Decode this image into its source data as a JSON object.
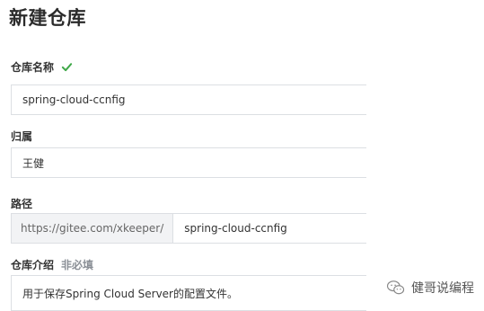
{
  "page": {
    "title": "新建仓库"
  },
  "form": {
    "repo_name": {
      "label": "仓库名称",
      "value": "spring-cloud-ccnfig",
      "valid_icon": "check-icon",
      "valid_color": "#3fa848"
    },
    "owner": {
      "label": "归属",
      "value": "王健"
    },
    "path": {
      "label": "路径",
      "prefix": "https://gitee.com/xkeeper/",
      "value": "spring-cloud-ccnfig"
    },
    "description": {
      "label": "仓库介绍",
      "optional_label": "非必填",
      "value": "用于保存Spring Cloud Server的配置文件。"
    }
  },
  "watermark": {
    "icon": "wechat-icon",
    "text": "健哥说编程"
  }
}
